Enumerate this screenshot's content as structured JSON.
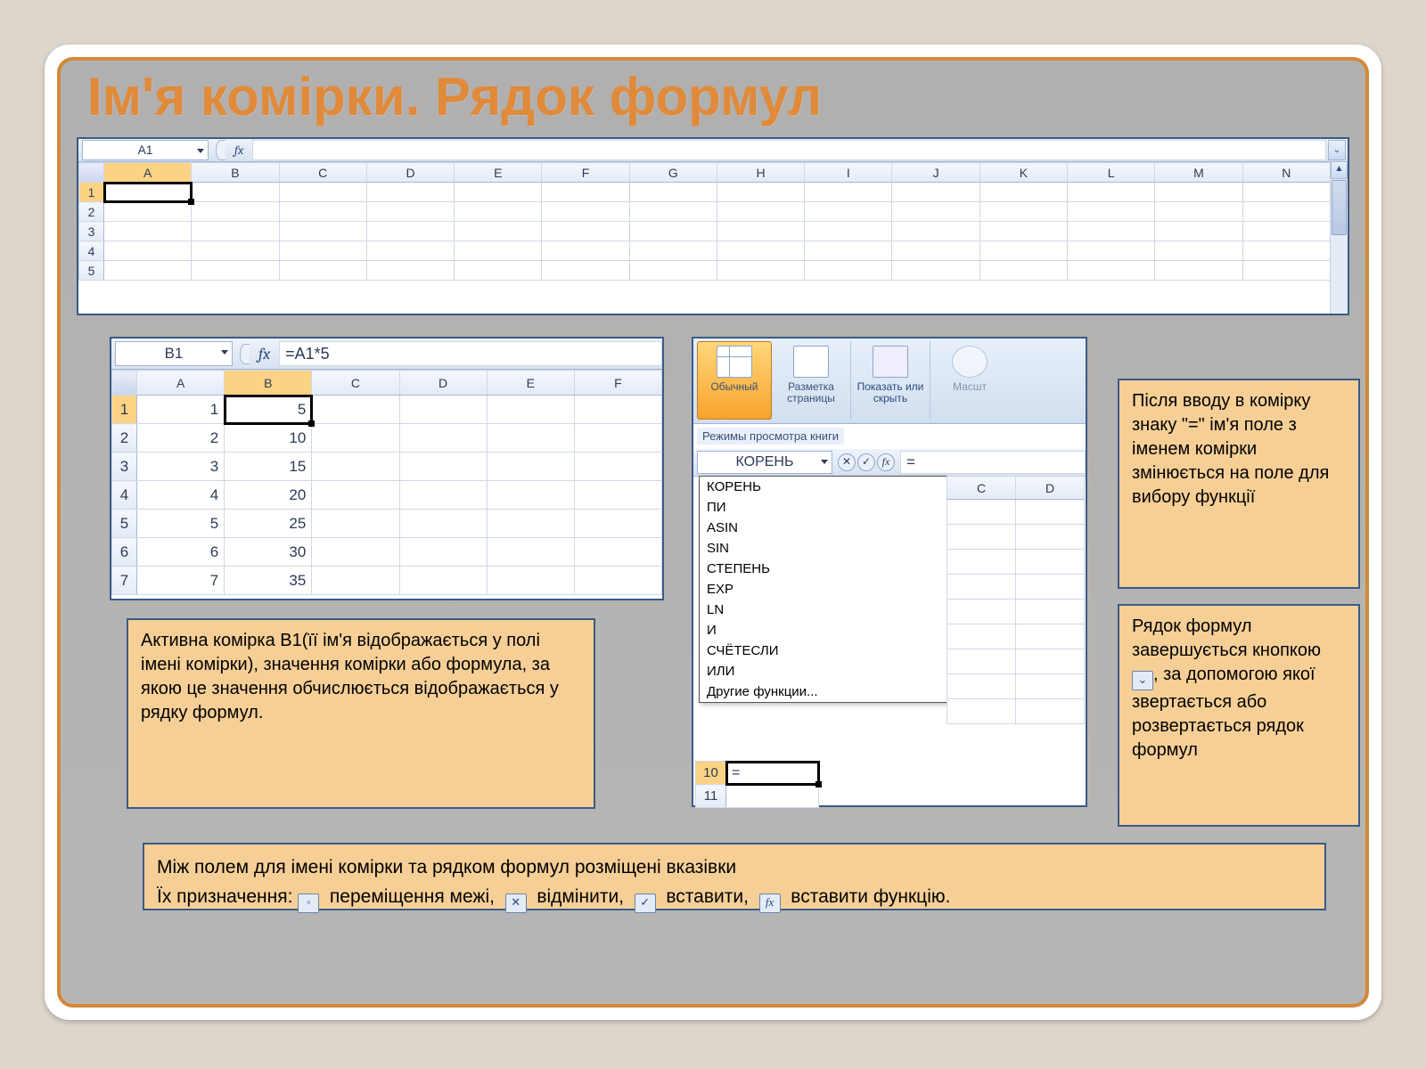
{
  "title": "Ім'я комірки. Рядок формул",
  "fig1": {
    "name_box": "A1",
    "fx": "fx",
    "columns": [
      "A",
      "B",
      "C",
      "D",
      "E",
      "F",
      "G",
      "H",
      "I",
      "J",
      "K",
      "L",
      "M",
      "N"
    ],
    "rows": [
      "1",
      "2",
      "3",
      "4",
      "5"
    ]
  },
  "fig2": {
    "name_box": "B1",
    "fx": "fx",
    "formula": "=A1*5",
    "columns": [
      "A",
      "B",
      "C",
      "D",
      "E",
      "F"
    ],
    "data": {
      "rows": [
        "1",
        "2",
        "3",
        "4",
        "5",
        "6",
        "7"
      ],
      "colA": [
        1,
        2,
        3,
        4,
        5,
        6,
        7
      ],
      "colB": [
        5,
        10,
        15,
        20,
        25,
        30,
        35
      ]
    }
  },
  "fig3": {
    "ribbon": {
      "items": [
        "Обычный",
        "Разметка страницы",
        "Показать или скрыть",
        "Масшт"
      ],
      "group_label": "Режимы просмотра книги"
    },
    "name_box": "КОРЕНЬ",
    "fx": "fx",
    "formula_value": "=",
    "dropdown": [
      "КОРЕНЬ",
      "ПИ",
      "ASIN",
      "SIN",
      "СТЕПЕНЬ",
      "EXP",
      "LN",
      "И",
      "СЧЁТЕСЛИ",
      "ИЛИ",
      "Другие функции..."
    ],
    "side_cols": [
      "C",
      "D"
    ],
    "bottom_rows": [
      "10",
      "11"
    ],
    "cell_value": "="
  },
  "callouts": {
    "a": "Після вводу в комірку знаку \"=\" ім'я поле з іменем комірки змінюється  на поле для вибору функції",
    "b_prefix": "Рядок формул завершується кнопкою ",
    "b_suffix": ", за допомогою якої звертається або розвертається рядок формул",
    "c": "Активна комірка B1(її ім'я відображається у полі імені комірки), значення комірки або формула, за якою це значення обчислюється  відображається у рядку формул.",
    "d_line1": "Між полем для імені комірки та рядком формул розміщені вказівки",
    "d_prefix": "Їх призначення: ",
    "d_move": "переміщення межі,",
    "d_cancel": "відмінити,",
    "d_ok": "вставити,",
    "d_fx": "вставити функцію."
  }
}
